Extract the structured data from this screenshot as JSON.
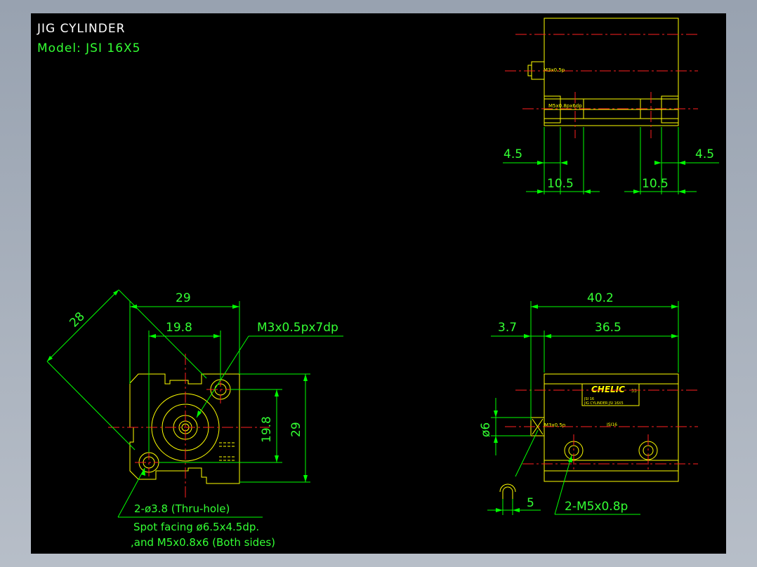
{
  "drawing": {
    "title": "JIG CYLINDER",
    "model": "Model: JSI 16X5"
  },
  "colors": {
    "background": "#000000",
    "outline": "#ffff00",
    "dimension": "#00ff00",
    "centerline": "#ff2020",
    "window_frame": "#a8b0bc"
  },
  "top_view": {
    "thread_side": "M3x0.5p",
    "thread_front": "M5x0.8px6dp",
    "dim_left_offset": "4.5",
    "dim_right_offset": "4.5",
    "dim_left_span": "10.5",
    "dim_right_span": "10.5"
  },
  "front_view": {
    "dim_diagonal": "28",
    "dim_width": "29",
    "dim_hole_spacing_h": "19.8",
    "dim_hole_spacing_v": "19.8",
    "dim_height": "29",
    "callout_top": "M3x0.5px7dp",
    "note_line1": "2-ø3.8 (Thru-hole)",
    "note_line2": "Spot facing ø6.5x4.5dp.",
    "note_line3": ",and M5x0.8x6 (Both sides)"
  },
  "side_view": {
    "dim_total_length": "40.2",
    "dim_offset": "3.7",
    "dim_body_length": "36.5",
    "dim_diameter": "ø6",
    "dim_rod": "5",
    "thread_side": "M3x0.5p",
    "label_brand": "CHELIC",
    "label_small_1": "JSI 16",
    "label_small_2": "JIG CYLINDER JSI 16X5",
    "part_code": "JSI16",
    "brand_suffix": "33",
    "callout_ports": "2-M5x0.8p"
  }
}
